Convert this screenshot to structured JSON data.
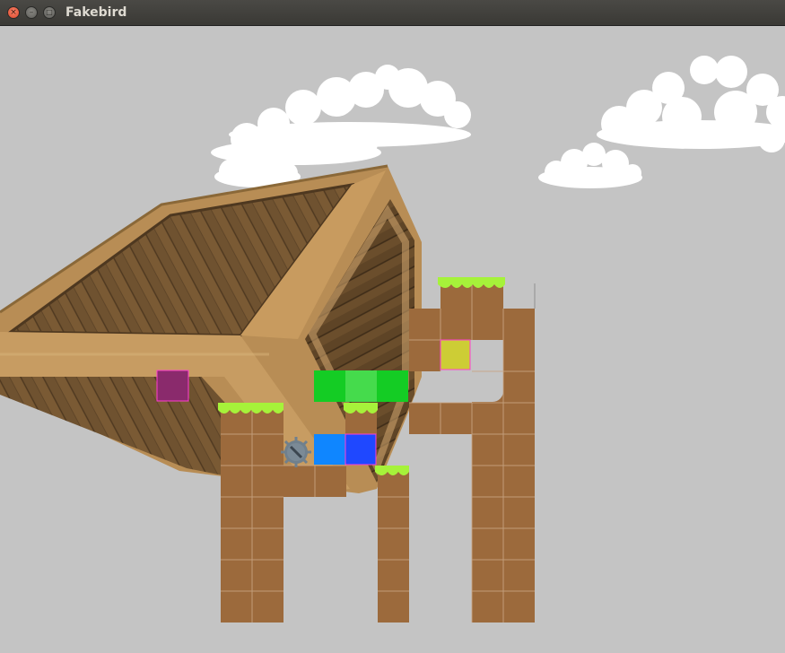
{
  "window": {
    "title": "Fakebird",
    "buttons": {
      "close": "×",
      "minimize": "–",
      "maximize": "□"
    }
  },
  "scene": {
    "background_color": "#c4c4c4",
    "dirt_color": "#9c6a3c",
    "grass_color": "#a6f23a",
    "cloud_color": "#ffffff",
    "crate_color": "#a98452",
    "entities": {
      "purple_gem": {
        "color": "#8a2a6c",
        "outline": "#ff3fd0"
      },
      "yellow_gem": {
        "color": "#cdcd35",
        "outline": "#ff3fd0"
      },
      "green_bird": {
        "colors": [
          "#14cc24",
          "#45db4c",
          "#14cc24"
        ],
        "segments": 3
      },
      "blue_bird": {
        "colors": [
          "#0f86ff",
          "#1f48ff"
        ],
        "segments": 2
      },
      "spike_ball": {
        "color": "#70808d",
        "icon": "spike-ball-icon"
      }
    }
  }
}
